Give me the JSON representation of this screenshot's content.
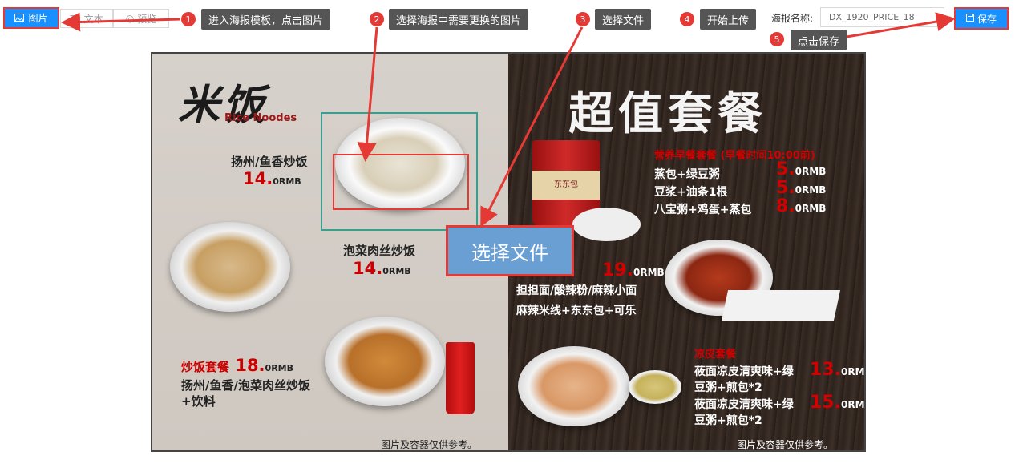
{
  "toolbar": {
    "image_tab": "图片",
    "text_tab": "文本",
    "preview_tab": "预览",
    "poster_name_label": "海报名称:",
    "poster_name_value": "DX_1920_PRICE_18",
    "save_label": "保存"
  },
  "annotations": [
    {
      "num": "1",
      "text": "进入海报模板，点击图片"
    },
    {
      "num": "2",
      "text": "选择海报中需要更换的图片"
    },
    {
      "num": "3",
      "text": "选择文件"
    },
    {
      "num": "4",
      "text": "开始上传"
    },
    {
      "num": "5",
      "text": "点击保存"
    }
  ],
  "upload_button": "选择文件",
  "poster": {
    "left": {
      "logo_cn": "米饭",
      "logo_en": "Rice Noodes",
      "items": [
        {
          "name": "扬州/鱼香炒饭",
          "price": "14.",
          "cents": "0",
          "unit": "RMB"
        },
        {
          "name": "泡菜肉丝炒饭",
          "price": "14.",
          "cents": "0",
          "unit": "RMB"
        }
      ],
      "combo": {
        "label": "炒饭套餐",
        "price": "18.",
        "cents": "0",
        "unit": "RMB",
        "line1": "扬州/鱼香/泡菜肉丝炒饭",
        "line2": "+饮料"
      },
      "note": "图片及容器仅供参考。"
    },
    "right": {
      "title": "超值套餐",
      "breakfast_title": "营养早餐套餐 (早餐时间10:00前)",
      "breakfast_items": [
        {
          "name": "蒸包+绿豆粥",
          "price": "5.",
          "cents": "0",
          "unit": "RMB"
        },
        {
          "name": "豆浆+油条1根",
          "price": "5.",
          "cents": "0",
          "unit": "RMB"
        },
        {
          "name": "八宝粥+鸡蛋+蒸包",
          "price": "8.",
          "cents": "0",
          "unit": "RMB"
        }
      ],
      "noodle_combo": {
        "price": "19.",
        "cents": "0",
        "unit": "RMB",
        "line1": "担担面/酸辣粉/麻辣小面",
        "line2": "麻辣米线+东东包+可乐"
      },
      "liangpi_title": "凉皮套餐",
      "liangpi_items": [
        {
          "line1": "莜面凉皮清爽味+绿",
          "line2": "豆粥+煎包*2",
          "price": "13.",
          "cents": "0",
          "unit": "RMB"
        },
        {
          "line1": "莜面凉皮清爽味+绿",
          "line2": "豆粥+煎包*2",
          "price": "15.",
          "cents": "0",
          "unit": "RMB"
        }
      ],
      "cup_brand": "东东包",
      "note": "图片及容器仅供参考。"
    }
  },
  "colors": {
    "primary": "#1890ff",
    "annotation": "#e53935",
    "price_red": "#c00000"
  }
}
